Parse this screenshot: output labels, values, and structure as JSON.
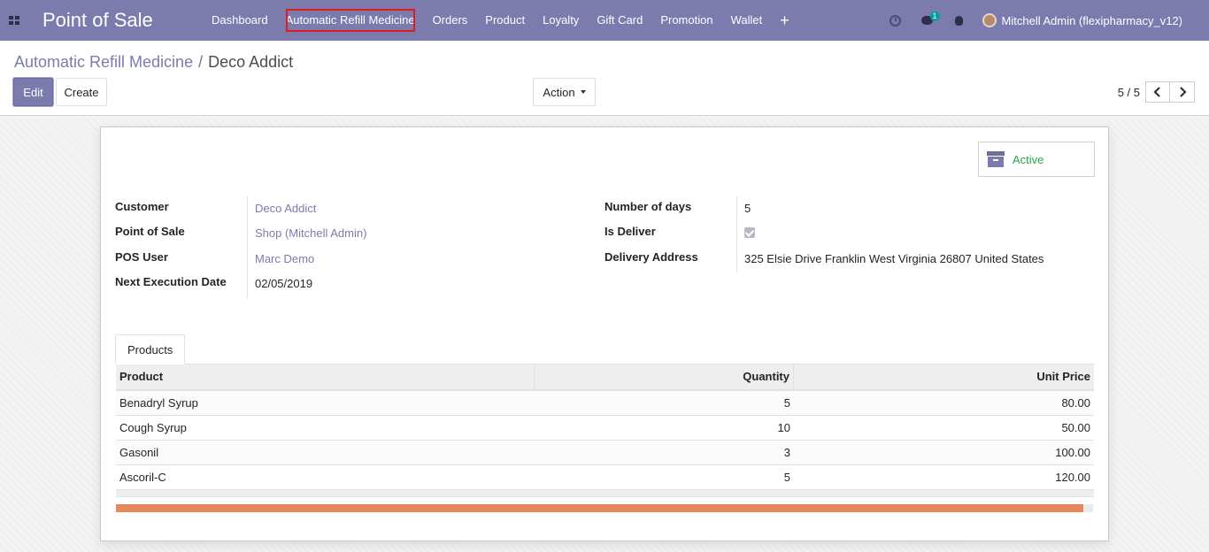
{
  "app": {
    "title": "Point of Sale"
  },
  "nav": {
    "items": [
      {
        "label": "Dashboard"
      },
      {
        "label": "Automatic Refill Medicine"
      },
      {
        "label": "Orders"
      },
      {
        "label": "Product"
      },
      {
        "label": "Loyalty"
      },
      {
        "label": "Gift Card"
      },
      {
        "label": "Promotion"
      },
      {
        "label": "Wallet"
      }
    ],
    "plus_icon": "+",
    "messages_badge": "1",
    "user_name": "Mitchell Admin (flexipharmacy_v12)"
  },
  "breadcrumb": {
    "parent": "Automatic Refill Medicine",
    "separator": "/",
    "current": "Deco Addict"
  },
  "buttons": {
    "edit": "Edit",
    "create": "Create",
    "action": "Action"
  },
  "pager": {
    "value": "5 / 5",
    "prev": "<",
    "next": ">"
  },
  "status": {
    "label": "Active",
    "color": "#28a745"
  },
  "fields": {
    "customer_label": "Customer",
    "customer_value": "Deco Addict",
    "pos_label": "Point of Sale",
    "pos_value": "Shop (Mitchell Admin)",
    "pos_user_label": "POS User",
    "pos_user_value": "Marc Demo",
    "next_exec_label": "Next Execution Date",
    "next_exec_value": "02/05/2019",
    "days_label": "Number of days",
    "days_value": "5",
    "deliver_label": "Is Deliver",
    "deliver_checked": true,
    "address_label": "Delivery Address",
    "address_value": "325 Elsie Drive Franklin West Virginia 26807 United States"
  },
  "tabs": [
    {
      "label": "Products"
    }
  ],
  "table": {
    "headers": {
      "product": "Product",
      "quantity": "Quantity",
      "price": "Unit Price"
    },
    "rows": [
      {
        "product": "Benadryl Syrup",
        "quantity": "5",
        "price": "80.00"
      },
      {
        "product": "Cough Syrup",
        "quantity": "10",
        "price": "50.00"
      },
      {
        "product": "Gasonil",
        "quantity": "3",
        "price": "100.00"
      },
      {
        "product": "Ascoril-C",
        "quantity": "5",
        "price": "120.00"
      }
    ]
  },
  "scroll": {
    "thumb_fraction": 0.99
  },
  "colors": {
    "primary": "#7c7bad",
    "highlight_outline": "#e01b1b",
    "scroll_thumb": "#e8875a"
  }
}
